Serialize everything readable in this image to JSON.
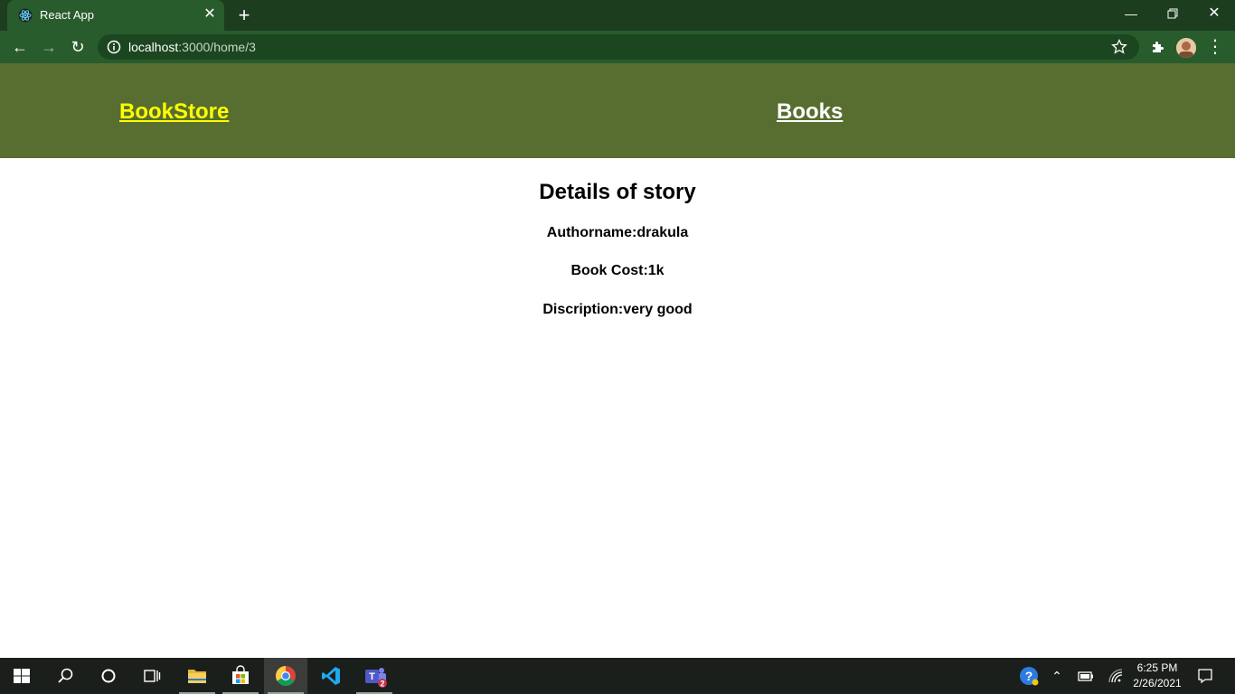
{
  "browser": {
    "tab_title": "React App",
    "url_host": "localhost",
    "url_path": ":3000/home/3"
  },
  "navbar": {
    "brand": "BookStore",
    "books_link": "Books"
  },
  "details": {
    "heading": "Details of story",
    "author_line": "Authorname:drakula",
    "cost_line": "Book Cost:1k",
    "description_line": "Discription:very good"
  },
  "taskbar": {
    "time": "6:25 PM",
    "date": "2/26/2021",
    "teams_badge": "2"
  },
  "colors": {
    "titlebar": "#1c3d1e",
    "toolbar": "#285c2c",
    "navbar": "#586e30",
    "brand_link": "#ffff00"
  }
}
